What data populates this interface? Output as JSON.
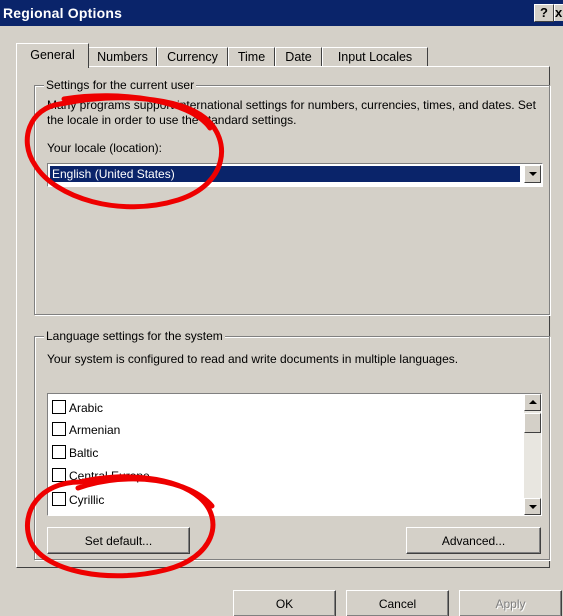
{
  "window": {
    "title": "Regional Options",
    "help_glyph": "?",
    "close_glyph": "x"
  },
  "tabs": [
    {
      "label": "General",
      "active": true
    },
    {
      "label": "Numbers",
      "active": false
    },
    {
      "label": "Currency",
      "active": false
    },
    {
      "label": "Time",
      "active": false
    },
    {
      "label": "Date",
      "active": false
    },
    {
      "label": "Input Locales",
      "active": false
    }
  ],
  "user_settings": {
    "legend": "Settings for the current user",
    "description": "Many programs support international settings for numbers, currencies, times, and dates. Set the locale in order to use the standard settings.",
    "locale_label": "Your locale (location):",
    "locale_value": "English (United States)"
  },
  "system_settings": {
    "legend": "Language settings for the system",
    "description": "Your system is configured to read and write documents in multiple languages.",
    "languages": [
      {
        "label": "Arabic",
        "checked": false
      },
      {
        "label": "Armenian",
        "checked": false
      },
      {
        "label": "Baltic",
        "checked": false
      },
      {
        "label": "Central Europe",
        "checked": false
      },
      {
        "label": "Cyrillic",
        "checked": false
      }
    ],
    "set_default_label": "Set default...",
    "advanced_label": "Advanced..."
  },
  "footer": {
    "ok_label": "OK",
    "cancel_label": "Cancel",
    "apply_label": "Apply"
  },
  "colors": {
    "titlebar": "#0a246a",
    "face": "#d4d0c8",
    "selection": "#0a246a",
    "annotation": "#ee0000"
  }
}
